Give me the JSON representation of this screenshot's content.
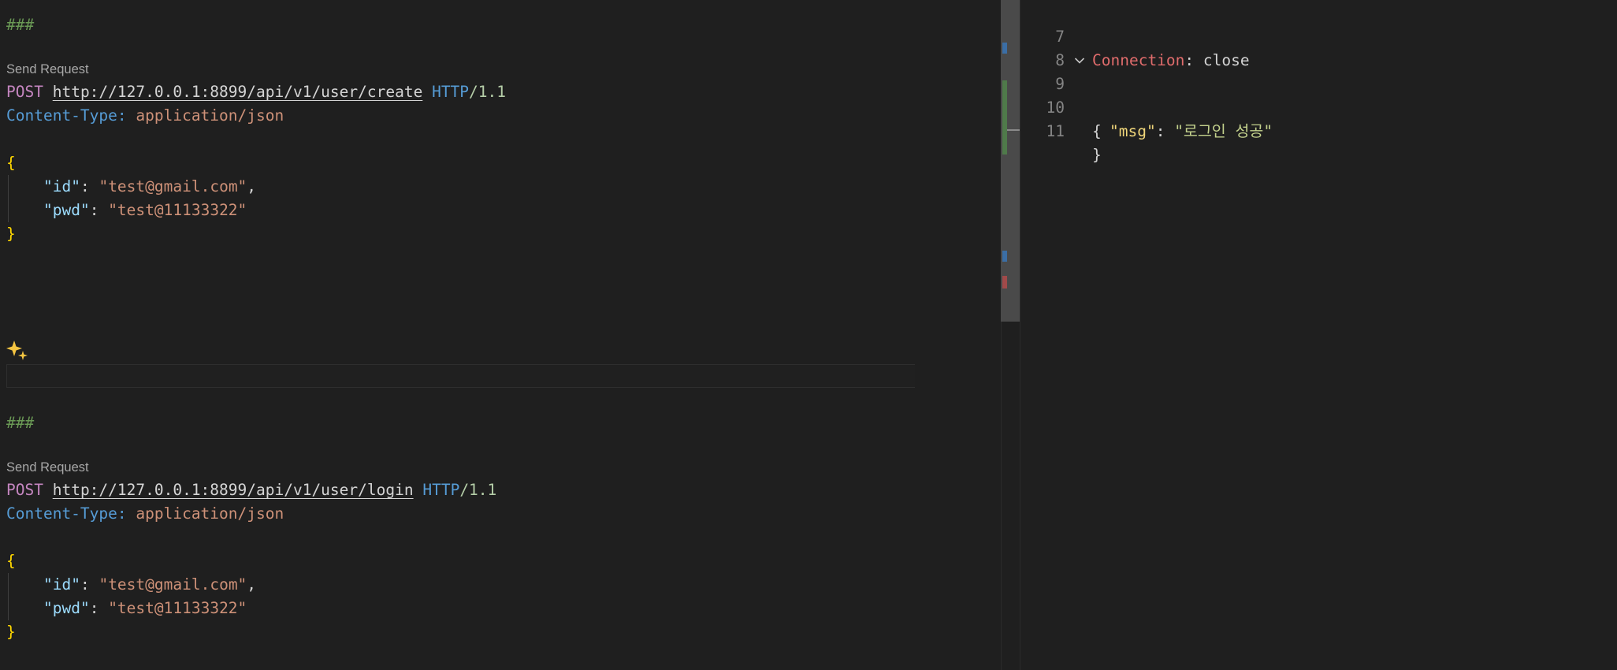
{
  "request_file": {
    "blocks": [
      {
        "separator": "###",
        "codelens": "Send Request",
        "method": "POST",
        "url": "http://127.0.0.1:8899/api/v1/user/create",
        "protocol": "HTTP",
        "version": "/1.1",
        "header_name": "Content-Type:",
        "header_value": "application/json",
        "body": {
          "open": "{",
          "key1": "\"id\"",
          "val1": "\"test@gmail.com\"",
          "key2": "\"pwd\"",
          "val2": "\"test@11133322\"",
          "close": "}"
        }
      },
      {
        "separator": "###",
        "codelens": "Send Request",
        "method": "POST",
        "url": "http://127.0.0.1:8899/api/v1/user/login",
        "protocol": "HTTP",
        "version": "/1.1",
        "header_name": "Content-Type:",
        "header_value": "application/json",
        "body": {
          "open": "{",
          "key1": "\"id\"",
          "val1": "\"test@gmail.com\"",
          "key2": "\"pwd\"",
          "val2": "\"test@11133322\"",
          "close": "}"
        }
      }
    ],
    "inline_chat_icon": "sparkle-icon"
  },
  "response": {
    "lines": [
      {
        "num": "7",
        "header_name": "Connection",
        "header_value": "close"
      },
      {
        "num": "8"
      },
      {
        "num": "9",
        "text": "{",
        "fold_icon": "chevron-down-icon"
      },
      {
        "num": "10",
        "key": "\"msg\"",
        "value": "\"로그인 성공\""
      },
      {
        "num": "11",
        "text": "}"
      }
    ]
  },
  "colors": {
    "background": "#1f1f1f",
    "comment": "#6a9955",
    "method": "#c586c0",
    "keyword_blue": "#569cd6",
    "string": "#ce9178",
    "brace": "#ffd700",
    "json_key": "#9cdcfe",
    "response_header": "#e06c6c",
    "response_key": "#f0d67a",
    "response_string": "#c3d18c"
  }
}
